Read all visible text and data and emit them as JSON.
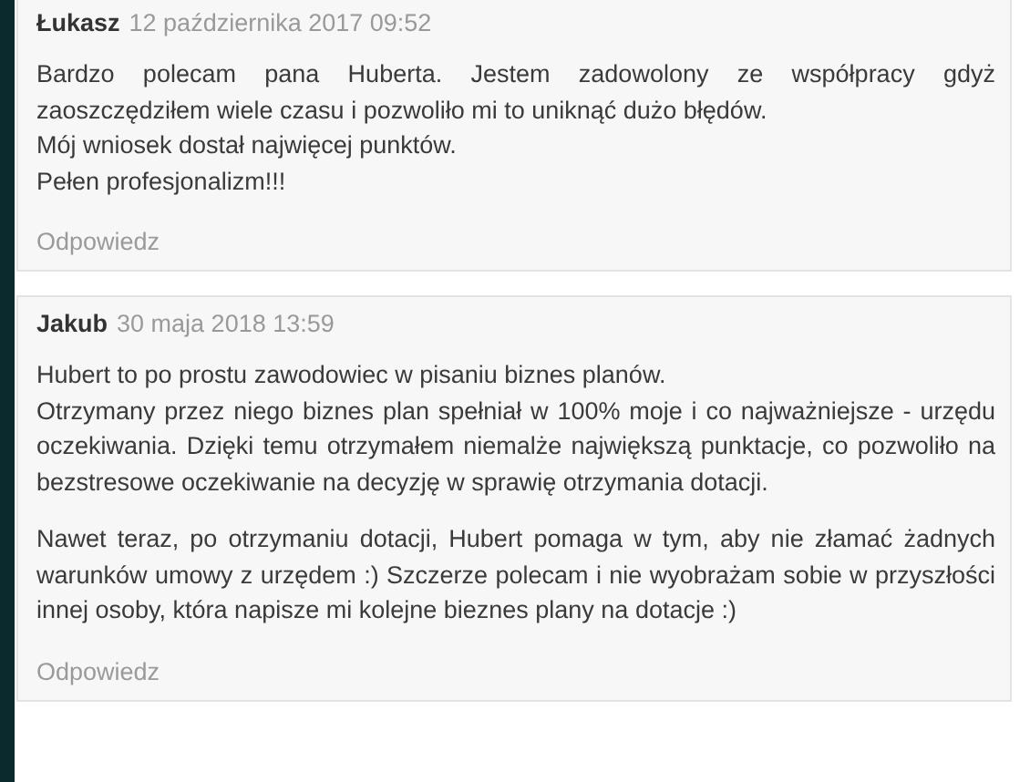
{
  "comments": [
    {
      "author": "Łukasz",
      "date": "12 października 2017 09:52",
      "paragraphs": [
        [
          "Bardzo polecam pana Huberta. Jestem zadowolony ze współpracy gdyż zaoszczędziłem wiele czasu i pozwoliło mi to uniknąć dużo błędów.",
          "Mój wniosek dostał najwięcej punktów.",
          "Pełen profesjonalizm!!!"
        ]
      ],
      "reply": "Odpowiedz"
    },
    {
      "author": "Jakub",
      "date": "30 maja 2018 13:59",
      "paragraphs": [
        [
          "Hubert to po prostu zawodowiec w pisaniu biznes planów.",
          "Otrzymany przez niego biznes plan spełniał w 100% moje i co najważniejsze - urzędu oczekiwania. Dzięki temu otrzymałem niemalże największą punktacje, co pozwoliło na bezstresowe oczekiwanie na decyzję w sprawię otrzymania dotacji."
        ],
        [
          "Nawet teraz, po otrzymaniu dotacji, Hubert pomaga w tym, aby nie złamać żadnych warunków umowy z urzędem :) Szczerze polecam i nie wyobrażam sobie w przyszłości innej osoby, która napisze mi kolejne bieznes plany na dotacje :)"
        ]
      ],
      "reply": "Odpowiedz"
    }
  ]
}
